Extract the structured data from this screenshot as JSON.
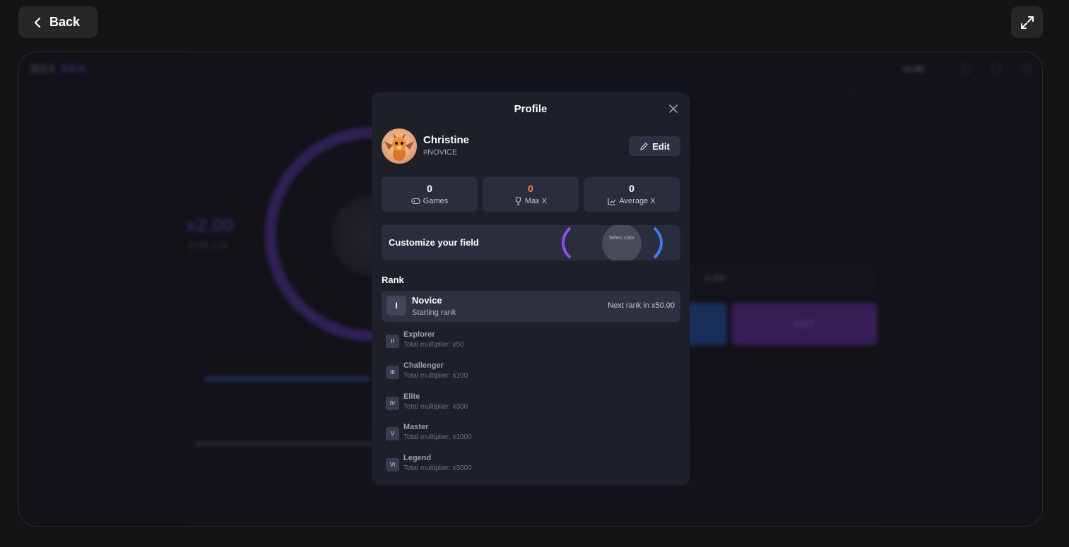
{
  "topbar": {
    "back_label": "Back",
    "back_icon": "chevron-left-icon",
    "expand_icon": "expand-icon"
  },
  "background_game": {
    "logo_main": "ВЕК",
    "logo_accent": "ВЕК",
    "balance": "19.80",
    "multiplier": "x2.00",
    "multiplier_sub": "EUR 2.02",
    "bet_amount": "1.00",
    "action_label": "GET"
  },
  "modal": {
    "title": "Profile",
    "user": {
      "name": "Christine",
      "tag": "#NOVICE",
      "edit_label": "Edit"
    },
    "stats": [
      {
        "value": "0",
        "label": "Games",
        "icon": "gamepad-icon",
        "color": "#ffffff"
      },
      {
        "value": "0",
        "label": "Max X",
        "icon": "trophy-icon",
        "color": "#f0864b"
      },
      {
        "value": "0",
        "label": "Average X",
        "icon": "chart-line-icon",
        "color": "#ffffff"
      }
    ],
    "customize": {
      "label": "Customize your field",
      "select_color_label": "Select color"
    },
    "rank": {
      "title": "Rank",
      "current": {
        "numeral": "I",
        "name": "Novice",
        "subtitle": "Starting rank",
        "next": "Next rank in x50.00"
      },
      "items": [
        {
          "numeral": "II",
          "name": "Explorer",
          "subtitle": "Total multiplier: x50"
        },
        {
          "numeral": "III",
          "name": "Challenger",
          "subtitle": "Total multiplier: x100"
        },
        {
          "numeral": "IV",
          "name": "Elite",
          "subtitle": "Total multiplier: x300"
        },
        {
          "numeral": "V",
          "name": "Master",
          "subtitle": "Total multiplier: x1000"
        },
        {
          "numeral": "VI",
          "name": "Legend",
          "subtitle": "Total multiplier: x3000"
        }
      ]
    }
  }
}
